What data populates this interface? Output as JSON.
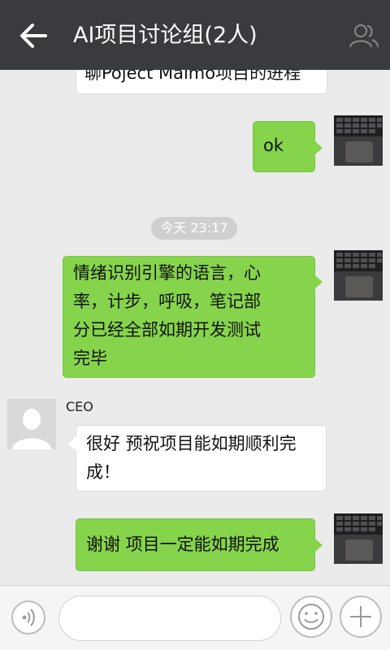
{
  "header": {
    "title": "AI项目讨论组(2人)",
    "back_icon": "arrow-left-icon",
    "contact_icon": "group-members-icon"
  },
  "messages": [
    {
      "from": "CEO",
      "side": "left",
      "text": "聊Poject Maimo项目的进程"
    },
    {
      "from": "me",
      "side": "right",
      "text": "ok"
    },
    {
      "from": "me",
      "side": "right",
      "lines": [
        "情绪识别引擎的语言，心",
        "率，计步，呼吸，笔记部",
        "分已经全部如期开发测试",
        "完毕"
      ]
    },
    {
      "from": "CEO",
      "side": "left",
      "sender_name": "CEO",
      "lines": [
        "很好 预祝项目能如期顺利完",
        "成！"
      ]
    },
    {
      "from": "me",
      "side": "right",
      "text": "谢谢 项目一定能如期完成"
    }
  ],
  "timestamp": "今天 23:17",
  "input_bar": {
    "placeholder": "",
    "voice_icon": "voice-icon",
    "emoji_icon": "smiley-icon",
    "more_icon": "plus-icon"
  },
  "colors": {
    "header_bg": "#3a3b3f",
    "chat_bg": "#ebebeb",
    "my_bubble": "#86d44b",
    "their_bubble": "#ffffff"
  }
}
